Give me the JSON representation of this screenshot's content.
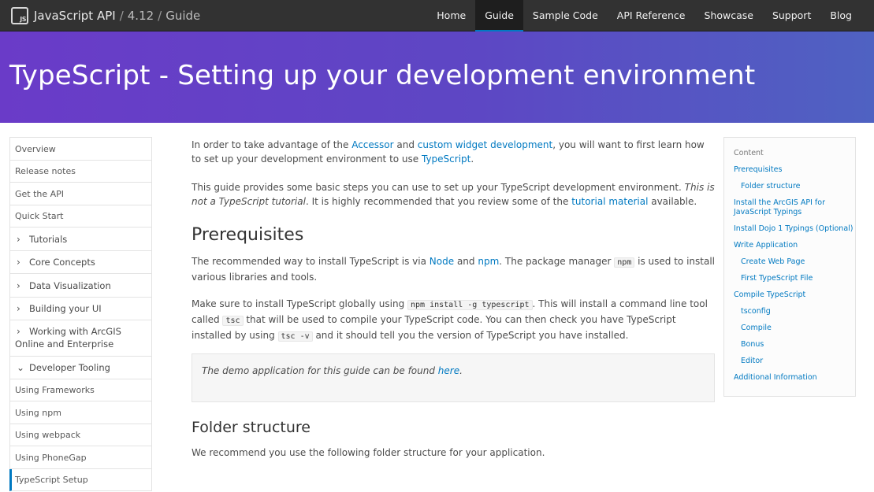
{
  "nav": {
    "logo_text": "JS",
    "title": "JavaScript API",
    "version": "4.12",
    "section": "Guide",
    "separator": "/",
    "links": [
      "Home",
      "Guide",
      "Sample Code",
      "API Reference",
      "Showcase",
      "Support",
      "Blog"
    ],
    "active_link": "Guide"
  },
  "banner": {
    "title": "TypeScript - Setting up your development environment"
  },
  "sidebar": {
    "items": [
      {
        "label": "Overview",
        "type": "link"
      },
      {
        "label": "Release notes",
        "type": "link"
      },
      {
        "label": "Get the API",
        "type": "link"
      },
      {
        "label": "Quick Start",
        "type": "link"
      },
      {
        "label": "Tutorials",
        "type": "section",
        "chevron": "right"
      },
      {
        "label": "Core Concepts",
        "type": "section",
        "chevron": "right"
      },
      {
        "label": "Data Visualization",
        "type": "section",
        "chevron": "right"
      },
      {
        "label": "Building your UI",
        "type": "section",
        "chevron": "right"
      },
      {
        "label": "Working with ArcGIS Online and Enterprise",
        "type": "section",
        "chevron": "right"
      },
      {
        "label": "Developer Tooling",
        "type": "section",
        "chevron": "down"
      },
      {
        "label": "Using Frameworks",
        "type": "link"
      },
      {
        "label": "Using npm",
        "type": "link"
      },
      {
        "label": "Using webpack",
        "type": "link"
      },
      {
        "label": "Using PhoneGap",
        "type": "link"
      },
      {
        "label": "TypeScript Setup",
        "type": "link",
        "active": true
      }
    ]
  },
  "content": {
    "intro": {
      "t1": "In order to take advantage of the ",
      "l1": "Accessor",
      "t2": " and ",
      "l2": "custom widget development",
      "t3": ", you will want to first learn how to set up your development environment to use ",
      "l3": "TypeScript",
      "t4": "."
    },
    "guide": {
      "t1": "This guide provides some basic steps you can use to set up your TypeScript development environment. ",
      "em": "This is not a TypeScript tutorial",
      "t2": ". It is highly recommended that you review some of the ",
      "l1": "tutorial material",
      "t3": " available."
    },
    "prereq_heading": "Prerequisites",
    "prereq1": {
      "t1": "The recommended way to install TypeScript is via ",
      "l1": "Node",
      "t2": " and ",
      "l2": "npm",
      "t3": ". The package manager ",
      "c1": "npm",
      "t4": " is used to install various libraries and tools."
    },
    "prereq2": {
      "t1": "Make sure to install TypeScript globally using ",
      "c1": "npm install -g typescript",
      "t2": ". This will install a command line tool called ",
      "c2": "tsc",
      "t3": " that will be used to compile your TypeScript code. You can then check you have TypeScript installed by using ",
      "c3": "tsc -v",
      "t4": " and it should tell you the version of TypeScript you have installed."
    },
    "note": {
      "t1": "The demo application for this guide can be found ",
      "l1": "here",
      "t2": "."
    },
    "folder_heading": "Folder structure",
    "folder_text": "We recommend you use the following folder structure for your application."
  },
  "toc": {
    "title": "Content",
    "items": [
      {
        "label": "Prerequisites",
        "level": 1
      },
      {
        "label": "Folder structure",
        "level": 2
      },
      {
        "label": "Install the ArcGIS API for JavaScript Typings",
        "level": 1
      },
      {
        "label": "Install Dojo 1 Typings (Optional)",
        "level": 1
      },
      {
        "label": "Write Application",
        "level": 1
      },
      {
        "label": "Create Web Page",
        "level": 2
      },
      {
        "label": "First TypeScript File",
        "level": 2
      },
      {
        "label": "Compile TypeScript",
        "level": 1
      },
      {
        "label": "tsconfig",
        "level": 2
      },
      {
        "label": "Compile",
        "level": 2
      },
      {
        "label": "Bonus",
        "level": 2
      },
      {
        "label": "Editor",
        "level": 2
      },
      {
        "label": "Additional Information",
        "level": 1
      }
    ]
  },
  "colors": {
    "nav_bg": "#323232",
    "accent": "#0079c1",
    "banner_start": "#6a3bc8",
    "banner_end": "#4f62c2"
  }
}
